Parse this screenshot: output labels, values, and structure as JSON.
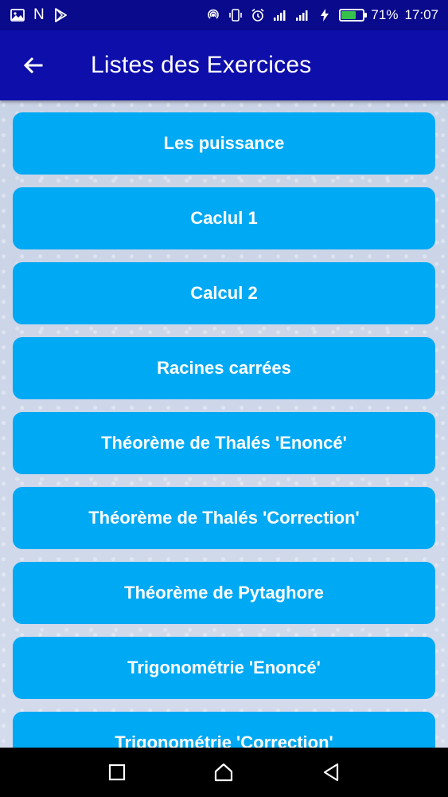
{
  "status_bar": {
    "icons_left": [
      "image-icon",
      "n-letter",
      "play-store-icon"
    ],
    "n_label": "N",
    "battery_percent": 71,
    "battery_label": "71%",
    "time": "17:07",
    "icons_right": [
      "hotspot-icon",
      "vibrate-icon",
      "alarm-icon",
      "signal-1-icon",
      "signal-2-icon",
      "charging-icon",
      "battery-icon"
    ]
  },
  "app_bar": {
    "title": "Listes des Exercices",
    "back_icon": "arrow-left-icon",
    "color": "#0e0eab"
  },
  "exercises": [
    {
      "label": "Les puissance"
    },
    {
      "label": "Caclul 1"
    },
    {
      "label": "Calcul 2"
    },
    {
      "label": "Racines carrées"
    },
    {
      "label": "Théorème de Thalés 'Enoncé'"
    },
    {
      "label": "Théorème de Thalés 'Correction'"
    },
    {
      "label": "Théorème de Pytaghore"
    },
    {
      "label": "Trigonométrie 'Enoncé'"
    },
    {
      "label": "Trigonométrie 'Correction'"
    }
  ],
  "button_color": "#00a9f4",
  "nav_bar": {
    "buttons": [
      "recents-square-icon",
      "home-icon",
      "back-triangle-icon"
    ]
  }
}
